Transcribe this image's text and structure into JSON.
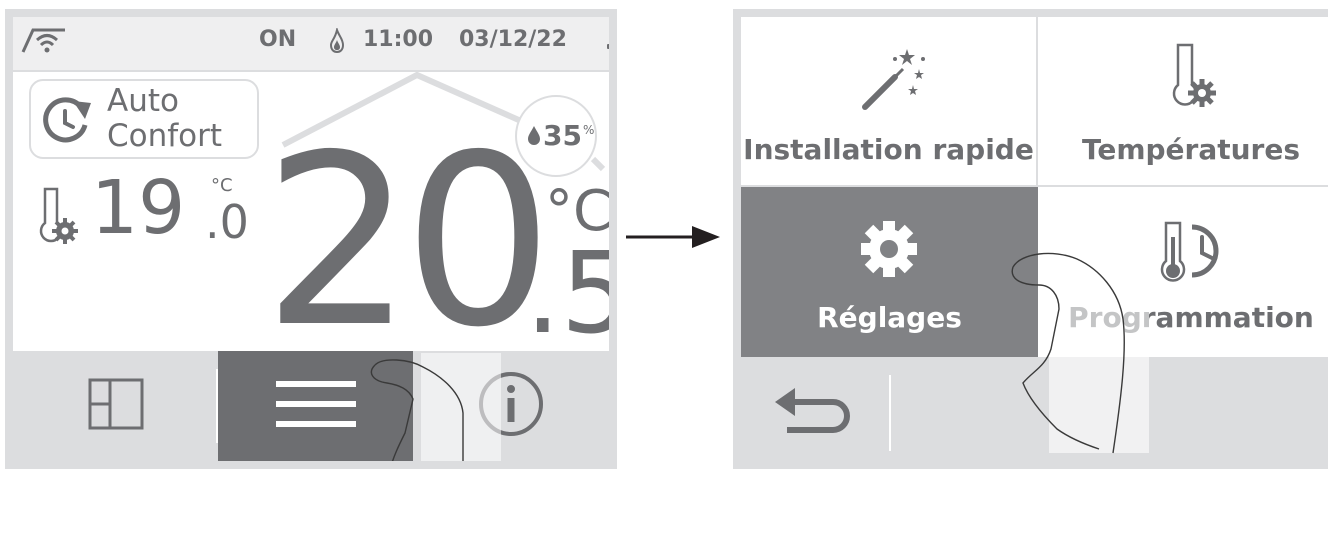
{
  "left_screen": {
    "status": {
      "state": "ON",
      "time": "11:00",
      "date": "03/12/22"
    },
    "mode": {
      "line1": "Auto",
      "line2": "Confort"
    },
    "setpoint": {
      "integer": "19",
      "decimal": ".0",
      "unit": "°C"
    },
    "humidity": {
      "value": "35",
      "unit": "%"
    },
    "temperature": {
      "integer": "20",
      "decimal": ".5",
      "unit": "°C"
    },
    "nav": {
      "items": [
        "rooms-icon",
        "menu-icon",
        "info-icon"
      ],
      "active": "menu-icon"
    }
  },
  "right_screen": {
    "tiles": [
      {
        "label": "Installation rapide",
        "icon": "magic-wand-icon"
      },
      {
        "label": "Températures",
        "icon": "thermometer-gear-icon"
      },
      {
        "label": "Réglages",
        "icon": "gear-icon"
      },
      {
        "label": "Programmation",
        "icon": "thermometer-clock-icon"
      }
    ],
    "active_tile": "Réglages",
    "back_icon": "back-arrow-icon"
  },
  "colors": {
    "text_gray": "#6d6e71",
    "border_gray": "#dcdddf",
    "active_dark": "#6d6e71",
    "active_tile": "#818285"
  }
}
